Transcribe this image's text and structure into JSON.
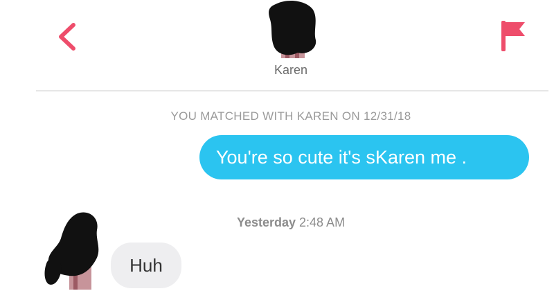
{
  "header": {
    "back_icon": "chevron-left-icon",
    "flag_icon": "flag-icon",
    "match_name": "Karen",
    "accent_color": "#ee4d6b"
  },
  "conversation": {
    "match_banner": "YOU MATCHED WITH KAREN ON 12/31/18",
    "messages": [
      {
        "from": "me",
        "text": "You're so cute it's sKaren me .",
        "bubble_color": "#2bc4f0"
      },
      {
        "from": "them",
        "text": "Huh",
        "bubble_color": "#eeeef0"
      }
    ],
    "timestamp": {
      "day": "Yesterday",
      "time": "2:48 AM"
    }
  }
}
